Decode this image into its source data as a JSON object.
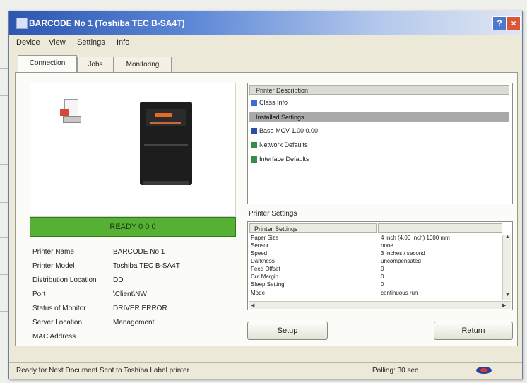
{
  "window": {
    "title": "BARCODE No 1 (Toshiba TEC B-SA4T)",
    "help_label": "?",
    "close_label": "×"
  },
  "menu": {
    "items": [
      "Device",
      "View",
      "Settings",
      "Info"
    ]
  },
  "tabs": [
    {
      "label": "Connection",
      "active": true
    },
    {
      "label": "Jobs",
      "active": false
    },
    {
      "label": "Monitoring",
      "active": false
    }
  ],
  "device": {
    "status_text": "READY 0 0 0",
    "info": [
      {
        "label": "Printer Name",
        "value": "BARCODE No 1"
      },
      {
        "label": "Printer Model",
        "value": "Toshiba TEC B-SA4T"
      },
      {
        "label": "Distribution Location",
        "value": "DD"
      },
      {
        "label": "Port",
        "value": "\\Client\\NW"
      },
      {
        "label": "Status of Monitor",
        "value": "DRIVER ERROR"
      },
      {
        "label": "Server Location",
        "value": "Management"
      },
      {
        "label": "MAC Address",
        "value": ""
      }
    ]
  },
  "printer_description": {
    "header": "Printer Description",
    "items": [
      {
        "text": "Class Info",
        "icon": "info-icon"
      }
    ],
    "subheader": "Installed Settings",
    "subitems": [
      {
        "text": "Base MCV 1.00 0.00",
        "icon": "chip-icon"
      },
      {
        "text": "Network Defaults",
        "icon": "network-icon"
      },
      {
        "text": "Interface Defaults",
        "icon": "interface-icon"
      }
    ]
  },
  "printer_settings": {
    "label": "Printer Settings",
    "header": "Printer Settings",
    "rows": [
      {
        "name": "Paper Size",
        "value": "4 Inch (4.00 Inch) 1000 mm"
      },
      {
        "name": "Sensor",
        "value": "none"
      },
      {
        "name": "Speed",
        "value": "3 Inches / second"
      },
      {
        "name": "Darkness",
        "value": "uncompensated"
      },
      {
        "name": "Feed Offset",
        "value": "0"
      },
      {
        "name": "Cut Margin",
        "value": "0"
      },
      {
        "name": "Sleep Setting",
        "value": "0"
      },
      {
        "name": "Mode",
        "value": "continuous run"
      }
    ]
  },
  "buttons": {
    "left": "Setup",
    "right": "Return"
  },
  "statusbar": {
    "left_text": "Ready for Next Document Sent to Toshiba Label printer",
    "right_text": "Polling: 30 sec"
  },
  "colors": {
    "status_green": "#55b033",
    "title_blue": "#2c56b0"
  }
}
